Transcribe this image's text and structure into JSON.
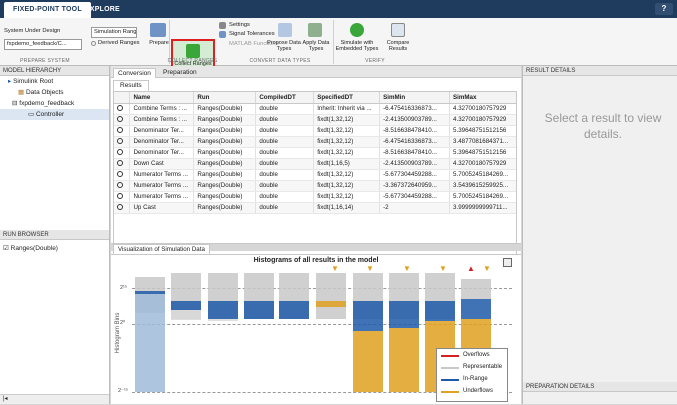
{
  "app": {
    "tabs": [
      "FIXED-POINT TOOL",
      "EXPLORE"
    ],
    "help": "?"
  },
  "ribbon": {
    "system_label": "System Under Design",
    "system_value": "fxpdemo_feedback/C...",
    "sim_value": "Simulation Ranges",
    "derived_value": "Derived Ranges",
    "prepare": "Prepare",
    "collect": "Collect Ranges",
    "settings": "Settings",
    "signal_tol": "Signal Tolerances",
    "matlab_fn": "MATLAB Functions",
    "propose": "Propose Data Types",
    "apply": "Apply Data Types",
    "simulate": "Simulate with Embedded Types",
    "compare": "Compare Results",
    "groups": [
      "PREPARE SYSTEM",
      "COLLECT RANGES",
      "CONVERT DATA TYPES",
      "VERIFY"
    ]
  },
  "model_hierarchy": {
    "title": "MODEL HIERARCHY",
    "items": [
      "Simulink Root",
      "Data Objects",
      "fxpdemo_feedback",
      "Controller"
    ]
  },
  "run_browser": {
    "title": "RUN BROWSER",
    "run": "Ranges(Double)"
  },
  "main_tabs": [
    "Conversion",
    "Preparation"
  ],
  "results_tab": "Results",
  "table": {
    "headers": [
      "Name",
      "Run",
      "CompiledDT",
      "SpecifiedDT",
      "SimMin",
      "SimMax"
    ],
    "rows": [
      [
        "Combine Terms : ...",
        "Ranges(Double)",
        "double",
        "Inherit: Inherit via ...",
        "-6.475416336873...",
        "4.32700180757929"
      ],
      [
        "Combine Terms : ...",
        "Ranges(Double)",
        "double",
        "fixdt(1,32,12)",
        "-2.413500903789...",
        "4.32700180757929"
      ],
      [
        "Denominator Ter...",
        "Ranges(Double)",
        "double",
        "fixdt(1,32,12)",
        "-8.516638478410...",
        "5.39648751512156"
      ],
      [
        "Denominator Ter...",
        "Ranges(Double)",
        "double",
        "fixdt(1,32,12)",
        "-6.475416336873...",
        "3.4877081684371..."
      ],
      [
        "Denominator Ter...",
        "Ranges(Double)",
        "double",
        "fixdt(1,32,12)",
        "-8.516638478410...",
        "5.39648751512156"
      ],
      [
        "Down Cast",
        "Ranges(Double)",
        "double",
        "fixdt(1,16,5)",
        "-2.413500903789...",
        "4.32700180757929"
      ],
      [
        "Numerator Terms ...",
        "Ranges(Double)",
        "double",
        "fixdt(1,32,12)",
        "-5.677304459288...",
        "5.7005245184269..."
      ],
      [
        "Numerator Terms ...",
        "Ranges(Double)",
        "double",
        "fixdt(1,32,12)",
        "-3.367372640959...",
        "3.5439615259925..."
      ],
      [
        "Numerator Terms ...",
        "Ranges(Double)",
        "double",
        "fixdt(1,32,12)",
        "-5.677304459288...",
        "5.7005245184269..."
      ],
      [
        "Up Cast",
        "Ranges(Double)",
        "double",
        "fixdt(1,16,14)",
        "-2",
        "3.9999999999711..."
      ]
    ]
  },
  "viz": {
    "tab": "Visualization of Simulation Data",
    "title": "Histograms of all results in the model",
    "ylabel": "Histogram Bins",
    "yticks": [
      "2¹⁵",
      "2⁰",
      "2⁻¹⁵"
    ],
    "legend": [
      "Overflows",
      "Representable",
      "In-Range",
      "Underflows"
    ],
    "colors": {
      "overflow": "#d62020",
      "representable": "#c8c8c8",
      "inrange": "#1f5aa8",
      "underflow": "#e0a020"
    }
  },
  "right_panel": {
    "title": "RESULT DETAILS",
    "message": "Select a result to view details.",
    "prep_details": "PREPARATION DETAILS"
  }
}
